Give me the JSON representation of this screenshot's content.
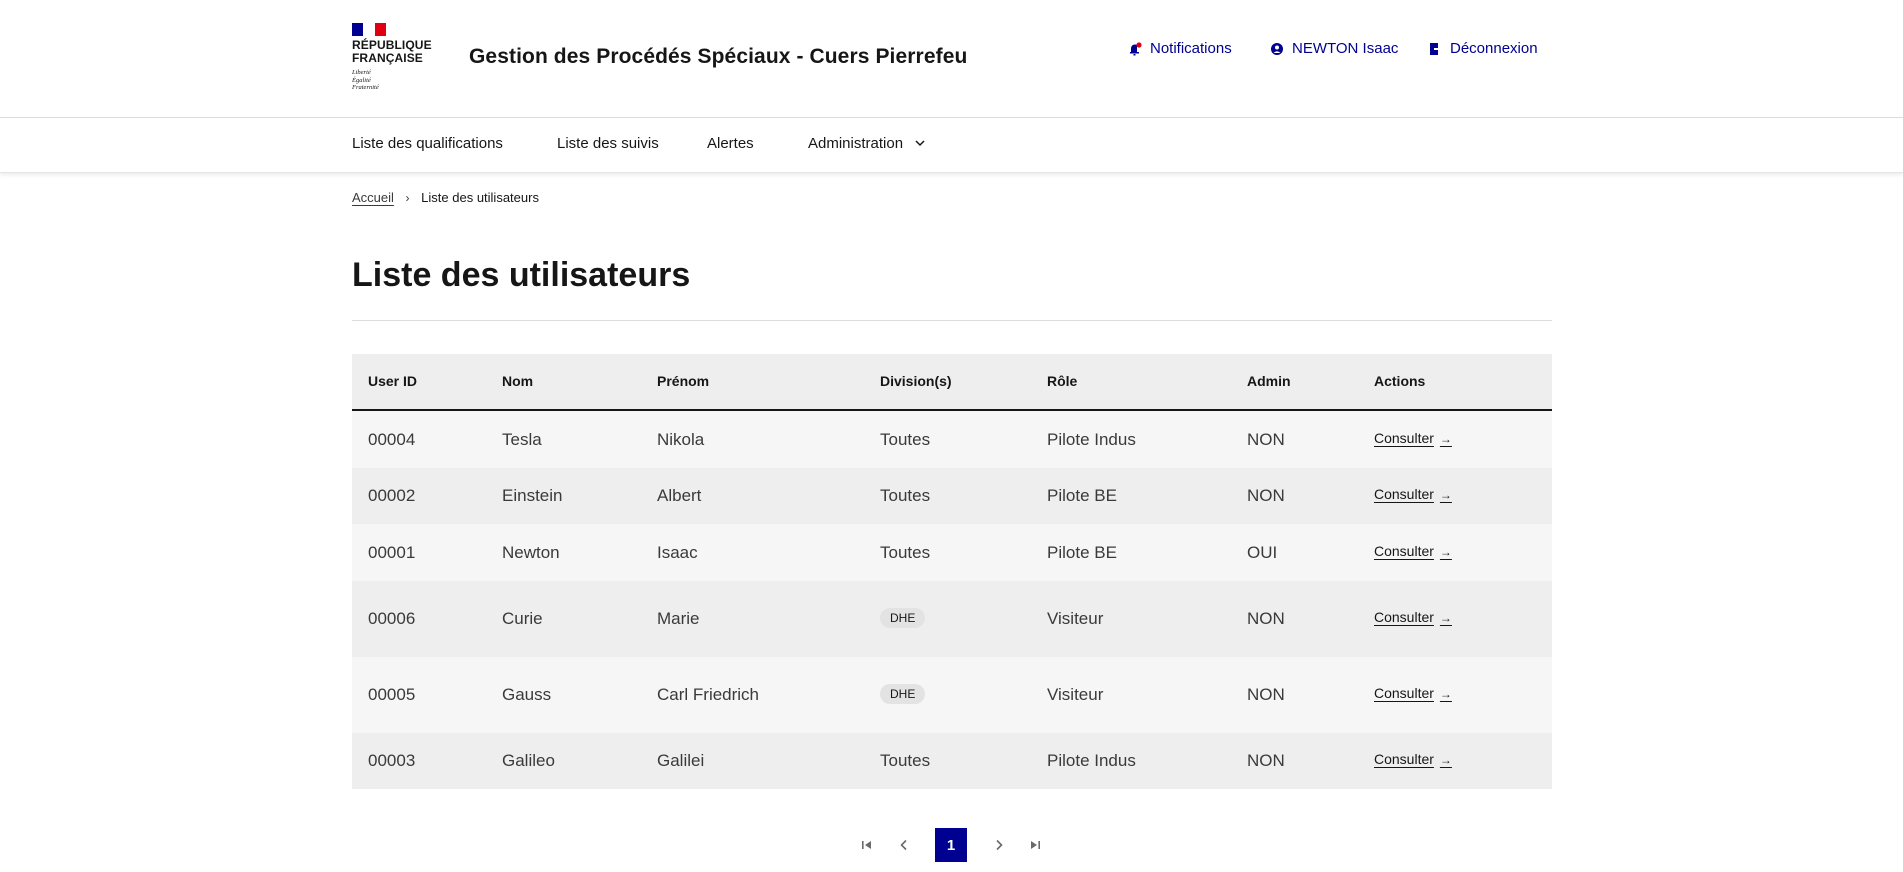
{
  "header": {
    "brand_line1": "RÉPUBLIQUE",
    "brand_line2": "FRANÇAISE",
    "devise": [
      "Liberté",
      "Égalité",
      "Fraternité"
    ],
    "site_title": "Gestion des Procédés Spéciaux - Cuers Pierrefeu",
    "tools": {
      "notifications": "Notifications",
      "user": "NEWTON Isaac",
      "logout": "Déconnexion"
    }
  },
  "nav": {
    "items": [
      "Liste des qualifications",
      "Liste des suivis",
      "Alertes",
      "Administration"
    ]
  },
  "breadcrumb": {
    "home": "Accueil",
    "current": "Liste des utilisateurs"
  },
  "page_title": "Liste des utilisateurs",
  "table": {
    "headers": [
      "User ID",
      "Nom",
      "Prénom",
      "Division(s)",
      "Rôle",
      "Admin",
      "Actions"
    ],
    "rows": [
      {
        "id": "00004",
        "nom": "Tesla",
        "prenom": "Nikola",
        "division": "Toutes",
        "division_tag": false,
        "role": "Pilote Indus",
        "admin": "NON",
        "action": "Consulter"
      },
      {
        "id": "00002",
        "nom": "Einstein",
        "prenom": "Albert",
        "division": "Toutes",
        "division_tag": false,
        "role": "Pilote BE",
        "admin": "NON",
        "action": "Consulter"
      },
      {
        "id": "00001",
        "nom": "Newton",
        "prenom": "Isaac",
        "division": "Toutes",
        "division_tag": false,
        "role": "Pilote BE",
        "admin": "OUI",
        "action": "Consulter"
      },
      {
        "id": "00006",
        "nom": "Curie",
        "prenom": "Marie",
        "division": "DHE",
        "division_tag": true,
        "role": "Visiteur",
        "admin": "NON",
        "action": "Consulter"
      },
      {
        "id": "00005",
        "nom": "Gauss",
        "prenom": "Carl Friedrich",
        "division": "DHE",
        "division_tag": true,
        "role": "Visiteur",
        "admin": "NON",
        "action": "Consulter"
      },
      {
        "id": "00003",
        "nom": "Galileo",
        "prenom": "Galilei",
        "division": "Toutes",
        "division_tag": false,
        "role": "Pilote Indus",
        "admin": "NON",
        "action": "Consulter"
      }
    ]
  },
  "pagination": {
    "current_page": "1",
    "icons": [
      "first-page-icon",
      "previous-page-icon",
      "next-page-icon",
      "last-page-icon"
    ]
  },
  "colors": {
    "primary_blue": "#000091",
    "flag_red": "#e1000f",
    "notification_dot": "#e1000f"
  }
}
